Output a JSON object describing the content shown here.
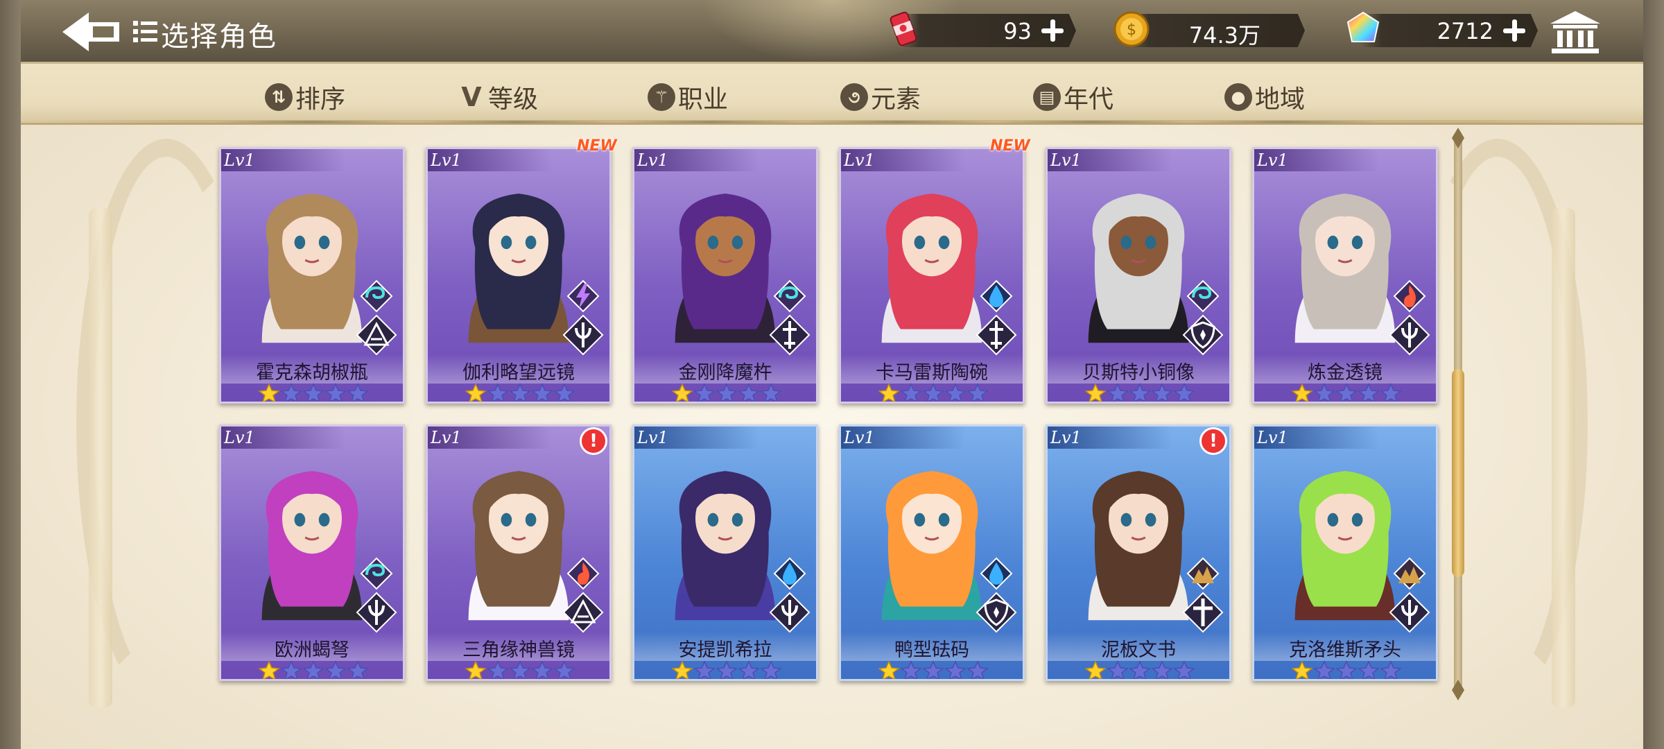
{
  "header": {
    "title": "选择角色",
    "currencies": [
      {
        "icon": "energy-can-icon",
        "value": "93"
      },
      {
        "icon": "gold-coin-icon",
        "value": "74.3万"
      },
      {
        "icon": "rainbow-gem-icon",
        "value": "2712"
      }
    ]
  },
  "filters": [
    {
      "icon": "sort-icon",
      "glyph": "⇅",
      "label": "排序"
    },
    {
      "icon": "level-icon",
      "glyph": "V",
      "label": "等级"
    },
    {
      "icon": "class-icon",
      "glyph": "⚚",
      "label": "职业"
    },
    {
      "icon": "element-icon",
      "glyph": "૭",
      "label": "元素"
    },
    {
      "icon": "era-icon",
      "glyph": "▤",
      "label": "年代"
    },
    {
      "icon": "region-icon",
      "glyph": "●",
      "label": "地域"
    }
  ],
  "cards": [
    {
      "level": "Lv1",
      "name": "霍克森胡椒瓶",
      "rarity": "purple",
      "stars": 1,
      "element": "wind",
      "class": "triangle",
      "new": false,
      "alert": false
    },
    {
      "level": "Lv1",
      "name": "伽利略望远镜",
      "rarity": "purple",
      "stars": 1,
      "element": "thunder",
      "class": "trident",
      "new": true,
      "alert": false
    },
    {
      "level": "Lv1",
      "name": "金刚降魔杵",
      "rarity": "purple",
      "stars": 1,
      "element": "wind",
      "class": "sword",
      "new": false,
      "alert": false
    },
    {
      "level": "Lv1",
      "name": "卡马雷斯陶碗",
      "rarity": "purple",
      "stars": 1,
      "element": "water",
      "class": "sword",
      "new": true,
      "alert": false
    },
    {
      "level": "Lv1",
      "name": "贝斯特小铜像",
      "rarity": "purple",
      "stars": 1,
      "element": "wind",
      "class": "shield",
      "new": false,
      "alert": false
    },
    {
      "level": "Lv1",
      "name": "炼金透镜",
      "rarity": "purple",
      "stars": 1,
      "element": "fire",
      "class": "trident",
      "new": false,
      "alert": false
    },
    {
      "level": "Lv1",
      "name": "欧洲蝎弩",
      "rarity": "purple",
      "stars": 1,
      "element": "wind",
      "class": "trident",
      "new": false,
      "alert": false
    },
    {
      "level": "Lv1",
      "name": "三角缘神兽镜",
      "rarity": "purple",
      "stars": 1,
      "element": "fire",
      "class": "triangle",
      "new": false,
      "alert": true
    },
    {
      "level": "Lv1",
      "name": "安提凯希拉",
      "rarity": "blue",
      "stars": 1,
      "element": "water",
      "class": "trident",
      "new": false,
      "alert": false
    },
    {
      "level": "Lv1",
      "name": "鸭型砝码",
      "rarity": "blue",
      "stars": 1,
      "element": "water",
      "class": "shield",
      "new": false,
      "alert": false
    },
    {
      "level": "Lv1",
      "name": "泥板文书",
      "rarity": "blue",
      "stars": 1,
      "element": "earth",
      "class": "cross",
      "new": false,
      "alert": true
    },
    {
      "level": "Lv1",
      "name": "克洛维斯矛头",
      "rarity": "blue",
      "stars": 1,
      "element": "earth",
      "class": "trident",
      "new": false,
      "alert": false
    }
  ],
  "scroll": {
    "position": 0.45
  },
  "colors": {
    "purple": "#7e5fc2",
    "blue": "#4d85d6",
    "star_on": "#ffd22a",
    "star_off": "#6a6fd6",
    "new_tag": "#ff5a1f"
  }
}
